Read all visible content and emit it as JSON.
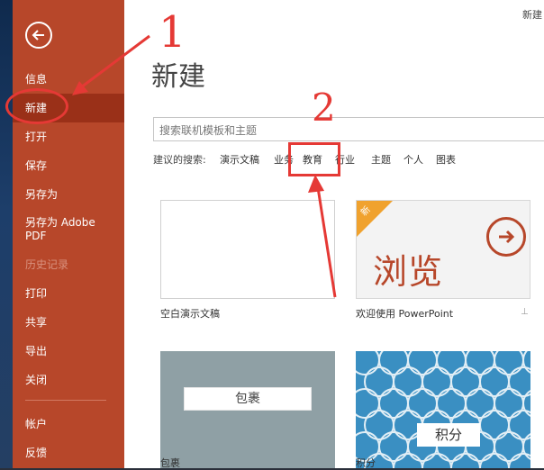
{
  "sidebar": {
    "items": [
      {
        "label": "信息"
      },
      {
        "label": "新建"
      },
      {
        "label": "打开"
      },
      {
        "label": "保存"
      },
      {
        "label": "另存为"
      },
      {
        "label": "另存为 Adobe PDF"
      },
      {
        "label": "历史记录"
      },
      {
        "label": "打印"
      },
      {
        "label": "共享"
      },
      {
        "label": "导出"
      },
      {
        "label": "关闭"
      },
      {
        "label": "帐户"
      },
      {
        "label": "反馈"
      }
    ]
  },
  "header": {
    "topright": "新建",
    "title": "新建"
  },
  "search": {
    "placeholder": "搜索联机模板和主题",
    "suggest_label": "建议的搜索:",
    "suggestions": [
      "演示文稿",
      "业务",
      "教育",
      "行业",
      "主题",
      "个人",
      "图表"
    ]
  },
  "templates": [
    {
      "caption": "空白演示文稿"
    },
    {
      "caption": "欢迎使用 PowerPoint",
      "badge": "新",
      "big_text": "浏览"
    },
    {
      "caption": "包裹",
      "tile_label": "包裹"
    },
    {
      "caption": "积分",
      "tile_label": "积分"
    }
  ],
  "annotations": {
    "step1": "1",
    "step2": "2"
  },
  "colors": {
    "sidebar": "#b7472a",
    "annotation": "#e53935",
    "badge": "#f0a22e"
  }
}
